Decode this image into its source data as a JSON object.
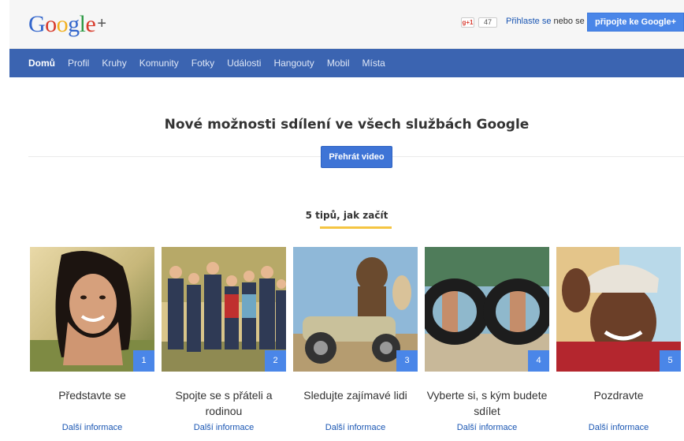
{
  "header": {
    "logo_text": "Google",
    "logo_plus": "+",
    "plusone_label": "g+1",
    "plusone_count": "47",
    "login_link": "Přihlaste se",
    "login_or": "nebo se",
    "join_button": "připojte ke Google+"
  },
  "nav": {
    "items": [
      "Domů",
      "Profil",
      "Kruhy",
      "Komunity",
      "Fotky",
      "Události",
      "Hangouty",
      "Mobil",
      "Místa"
    ]
  },
  "hero": {
    "title": "Nové možnosti sdílení ve všech službách Google",
    "video_button": "Přehrát video"
  },
  "tips": {
    "title": "5 tipů, jak začít",
    "items": [
      {
        "number": "1",
        "title": "Představte se",
        "link": "Další informace",
        "image": "smiling-woman-photo"
      },
      {
        "number": "2",
        "title": "Spojte se s přáteli a rodinou",
        "link": "Další informace",
        "image": "group-of-friends-photo"
      },
      {
        "number": "3",
        "title": "Sledujte zajímavé lidi",
        "link": "Další informace",
        "image": "mascots-on-motorcycle-photo"
      },
      {
        "number": "4",
        "title": "Vyberte si, s kým budete sdílet",
        "link": "Další informace",
        "image": "inner-tubes-photo"
      },
      {
        "number": "5",
        "title": "Pozdravte",
        "link": "Další informace",
        "image": "waving-man-photo"
      }
    ]
  },
  "colors": {
    "nav_bg": "#3b64b1",
    "accent": "#4a86e8",
    "link": "#1a56b3",
    "underline": "#f5c542"
  }
}
